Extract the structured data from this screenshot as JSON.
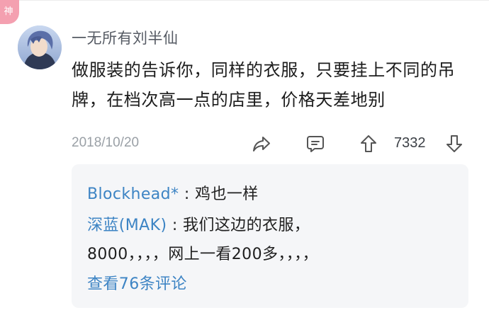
{
  "badge": {
    "label": "神"
  },
  "comment": {
    "username": "一无所有刘半仙",
    "text": "做服装的告诉你，同样的衣服，只要挂上不同的吊牌，在档次高一点的店里，价格天差地别",
    "date": "2018/10/20",
    "upvotes": "7332"
  },
  "replies": [
    {
      "author": "Blockhead*",
      "separator": " : ",
      "text": "鸡也一样"
    },
    {
      "author": "深蓝(MAK)",
      "separator": " : ",
      "text": "我们这边的衣服，",
      "continuation": "8000，，，，网上一看200多，，，，"
    }
  ],
  "more_replies": "查看76条评论",
  "icons": {
    "share": "share-icon",
    "comment": "comment-icon",
    "upvote": "upvote-icon",
    "downvote": "downvote-icon"
  }
}
